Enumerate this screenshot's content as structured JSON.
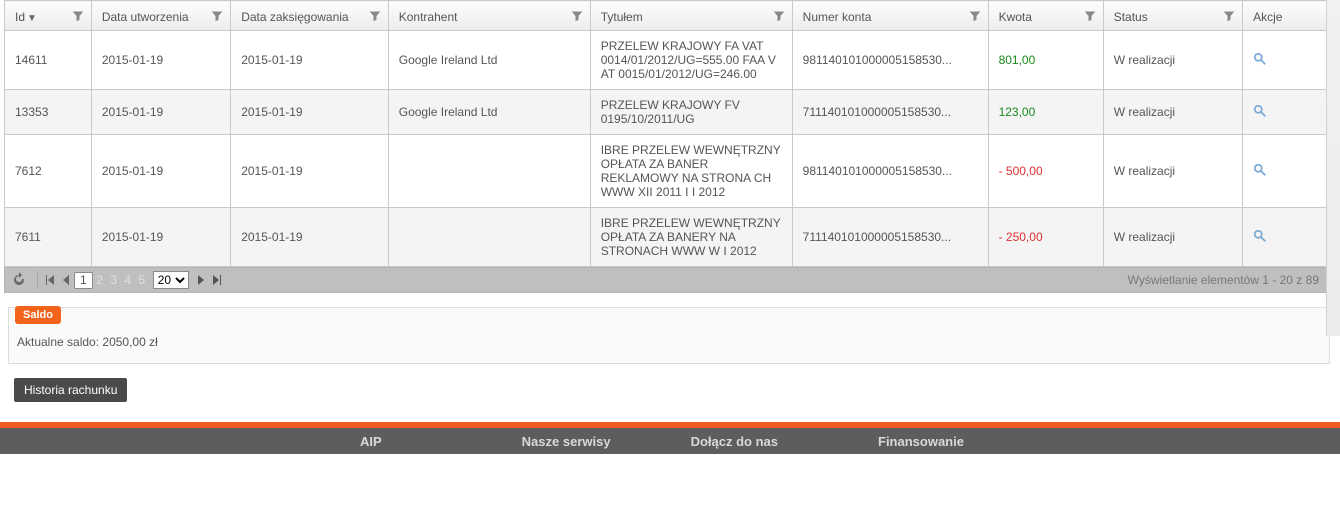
{
  "headers": {
    "id": "Id",
    "created": "Data utworzenia",
    "booked": "Data zaksięgowania",
    "contractor": "Kontrahent",
    "title": "Tytułem",
    "account": "Numer konta",
    "amount": "Kwota",
    "status": "Status",
    "actions": "Akcje"
  },
  "rows": [
    {
      "id": "14611",
      "created": "2015-01-19",
      "booked": "2015-01-19",
      "contractor": "Google Ireland Ltd",
      "title": "PRZELEW KRAJOWY FA VAT 0014/01/2012/UG=555.00 FAA V AT 0015/01/2012/UG=246.00",
      "account": "981140101000005158530...",
      "amount": "801,00",
      "amountClass": "amt-pos",
      "status": "W realizacji"
    },
    {
      "id": "13353",
      "created": "2015-01-19",
      "booked": "2015-01-19",
      "contractor": "Google Ireland Ltd",
      "title": "PRZELEW KRAJOWY FV 0195/10/2011/UG",
      "account": "711140101000005158530...",
      "amount": "123,00",
      "amountClass": "amt-pos",
      "status": "W realizacji"
    },
    {
      "id": "7612",
      "created": "2015-01-19",
      "booked": "2015-01-19",
      "contractor": "",
      "title": "IBRE PRZELEW WEWNĘTRZNY OPŁATA ZA BANER REKLAMOWY NA STRONA CH WWW XII 2011 I I 2012",
      "account": "981140101000005158530...",
      "amount": "- 500,00",
      "amountClass": "amt-neg",
      "status": "W realizacji"
    },
    {
      "id": "7611",
      "created": "2015-01-19",
      "booked": "2015-01-19",
      "contractor": "",
      "title": "IBRE PRZELEW WEWNĘTRZNY OPŁATA ZA BANERY NA STRONACH WWW W I 2012",
      "account": "711140101000005158530...",
      "amount": "- 250,00",
      "amountClass": "amt-neg",
      "status": "W realizacji"
    }
  ],
  "pager": {
    "pages": [
      "1",
      "2",
      "3",
      "4",
      "5"
    ],
    "current": "1",
    "pageSize": "20",
    "info": "Wyświetlanie elementów 1 - 20 z 89"
  },
  "saldo": {
    "tag": "Saldo",
    "label": "Aktualne saldo: ",
    "value": "2050,00 zł"
  },
  "historyButton": "Historia rachunku",
  "footer": {
    "c1": "AIP",
    "c2": "Nasze serwisy",
    "c3": "Dołącz do nas",
    "c4": "Finansowanie"
  }
}
